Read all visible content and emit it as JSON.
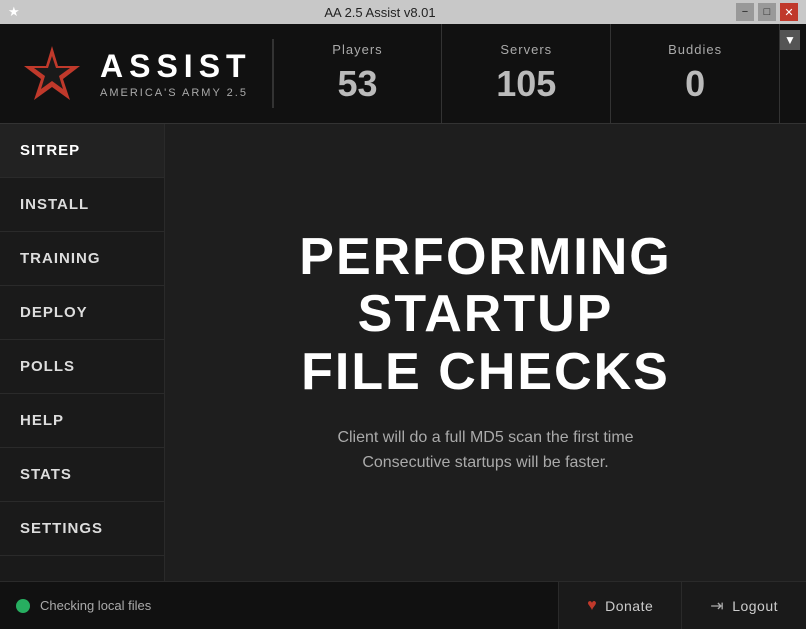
{
  "titlebar": {
    "title": "AA 2.5 Assist v8.01",
    "minimize": "−",
    "maximize": "□",
    "close": "✕"
  },
  "header": {
    "logo": {
      "name": "ASSIST",
      "subtitle": "AMERICA'S ARMY 2.5"
    },
    "stats": {
      "players": {
        "label": "Players",
        "value": "53"
      },
      "servers": {
        "label": "Servers",
        "value": "105"
      },
      "buddies": {
        "label": "Buddies",
        "value": "0"
      }
    }
  },
  "sidebar": {
    "items": [
      {
        "id": "sitrep",
        "label": "SITREP"
      },
      {
        "id": "install",
        "label": "INSTALL"
      },
      {
        "id": "training",
        "label": "TRAINING"
      },
      {
        "id": "deploy",
        "label": "DEPLOY"
      },
      {
        "id": "polls",
        "label": "POLLS"
      },
      {
        "id": "help",
        "label": "HELP"
      },
      {
        "id": "stats",
        "label": "STATS"
      },
      {
        "id": "settings",
        "label": "SETTINGS"
      }
    ]
  },
  "content": {
    "heading_line1": "PERFORMING STARTUP",
    "heading_line2": "FILE CHECKS",
    "description_line1": "Client will do a full MD5 scan the first time",
    "description_line2": "Consecutive startups will be faster."
  },
  "footer": {
    "status_text": "Checking local files",
    "donate_label": "Donate",
    "logout_label": "Logout"
  }
}
